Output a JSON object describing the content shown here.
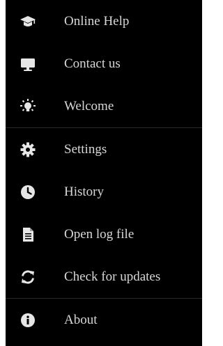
{
  "menu": {
    "groups": [
      {
        "items": [
          {
            "label": "Online Help",
            "icon": "graduation-cap-icon"
          },
          {
            "label": "Contact us",
            "icon": "monitor-icon"
          },
          {
            "label": "Welcome",
            "icon": "lightbulb-icon"
          }
        ]
      },
      {
        "items": [
          {
            "label": "Settings",
            "icon": "gear-icon"
          },
          {
            "label": "History",
            "icon": "clock-icon"
          },
          {
            "label": "Open log file",
            "icon": "document-icon"
          },
          {
            "label": "Check for updates",
            "icon": "refresh-icon"
          }
        ]
      },
      {
        "items": [
          {
            "label": "About",
            "icon": "info-icon"
          }
        ]
      }
    ]
  },
  "colors": {
    "background": "#000000",
    "text": "#d8d8d8",
    "icon": "#e6e6e6",
    "divider": "#2a2a2a"
  }
}
